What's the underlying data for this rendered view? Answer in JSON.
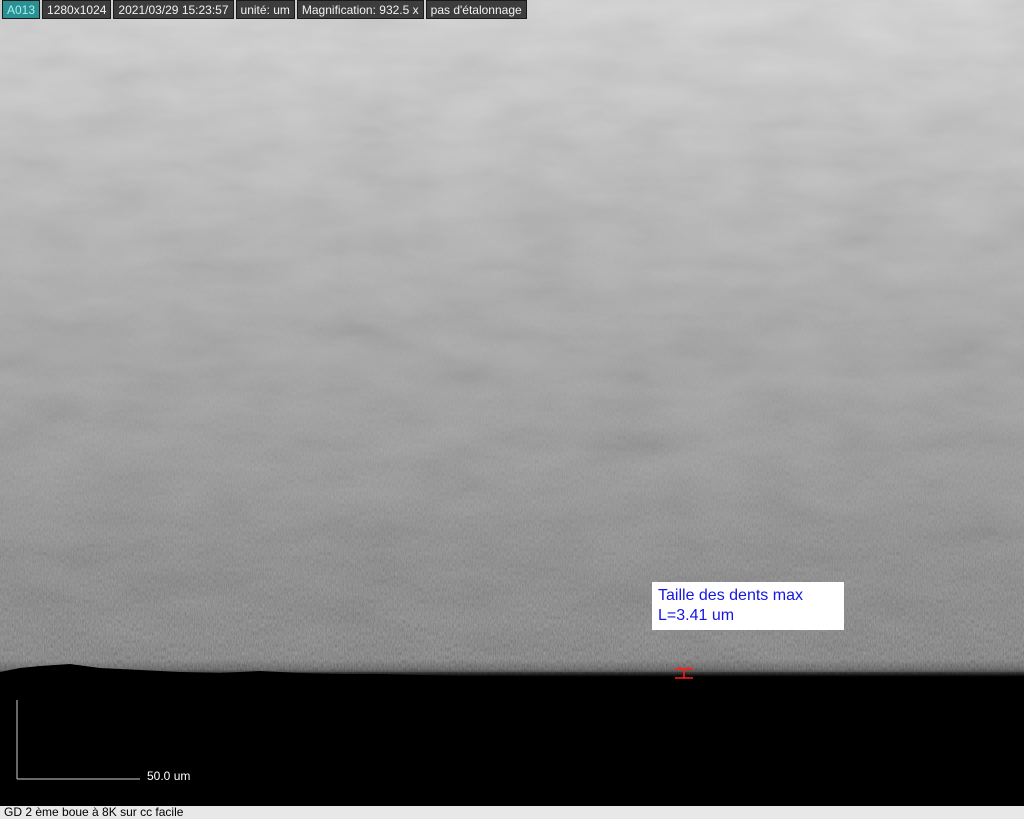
{
  "info_bar": {
    "image_id": "A013",
    "resolution": "1280x1024",
    "datetime": "2021/03/29 15:23:57",
    "unit": "unité: um",
    "magnification": "Magnification:  932.5 x",
    "calibration": "pas d'étalonnage"
  },
  "annotation": {
    "title": "Taille des dents max",
    "length": "L=3.41 um",
    "color": "#1515e6"
  },
  "scale_bar": {
    "label": "50.0 um"
  },
  "caption": {
    "text": "GD 2 ème boue à 8K sur cc facile"
  },
  "colors": {
    "id_badge": "#2c8f92",
    "info_cell": "#3d3d3d",
    "measure_marker": "#ff1a1a"
  }
}
